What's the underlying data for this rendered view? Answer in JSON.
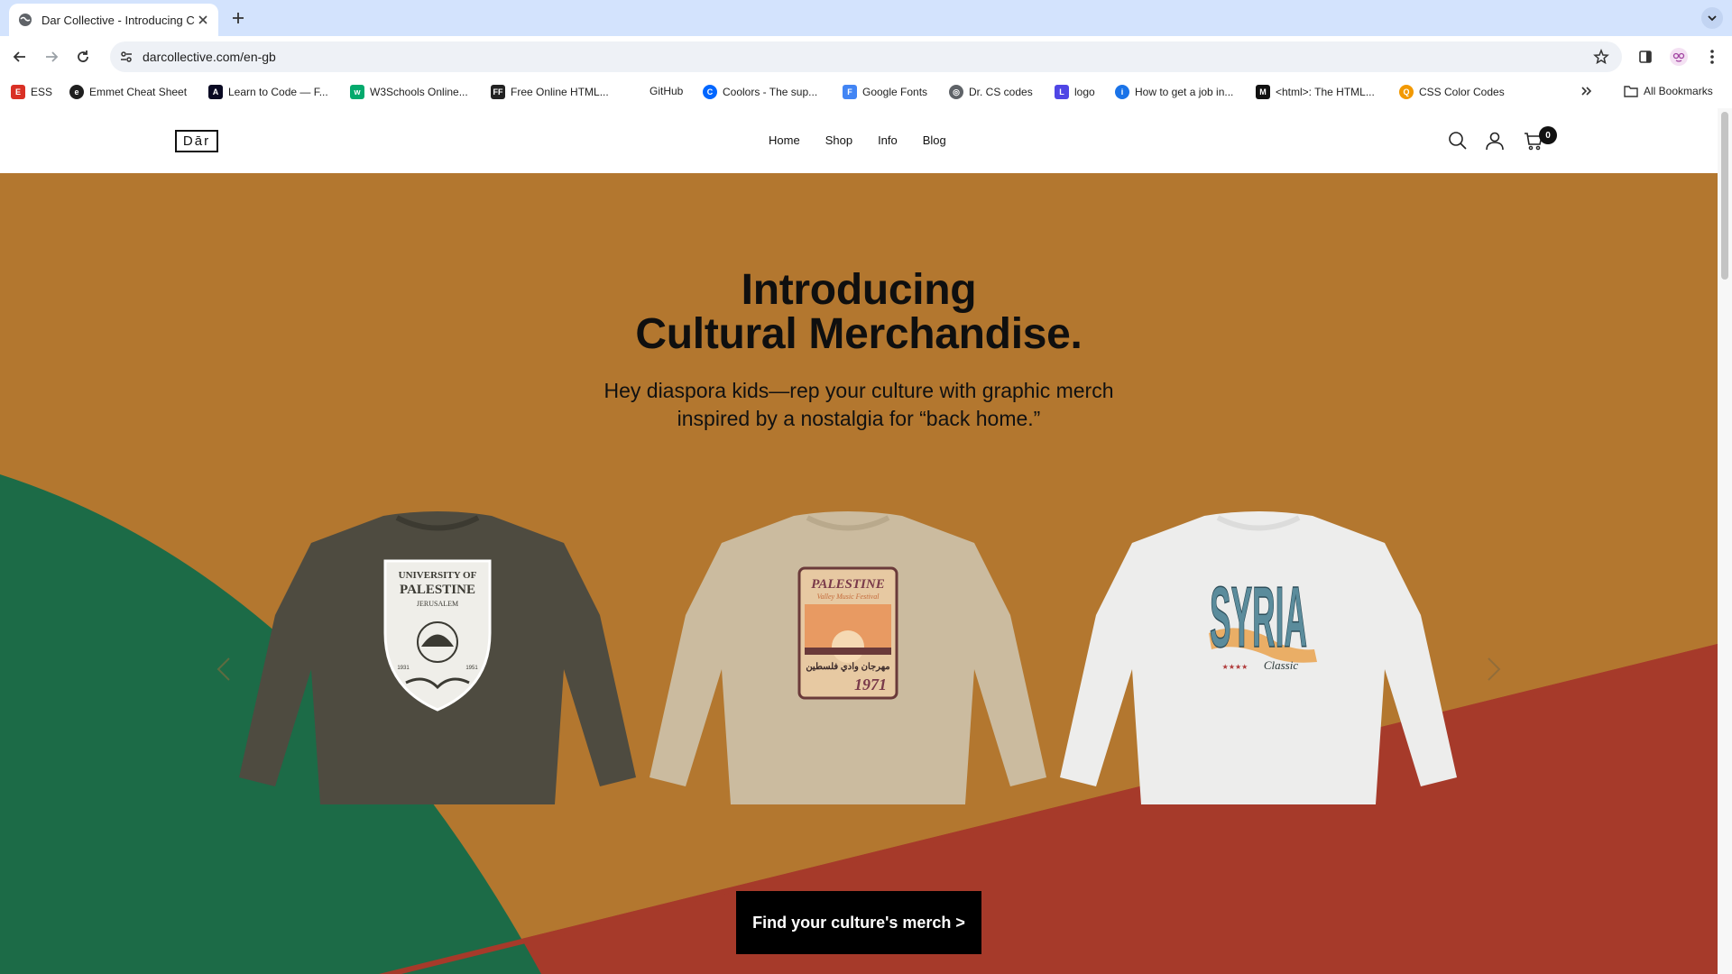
{
  "browser": {
    "tab_title": "Dar Collective - Introducing C",
    "url": "darcollective.com/en-gb",
    "bookmarks": [
      {
        "label": "ESS",
        "icon": "ess-icon",
        "color": "#d93025"
      },
      {
        "label": "Emmet Cheat Sheet",
        "icon": "emmet-icon",
        "color": "#1f1f1f"
      },
      {
        "label": "Learn to Code — F...",
        "icon": "freecodecamp-icon",
        "color": "#0a0a23"
      },
      {
        "label": "W3Schools Online...",
        "icon": "w3schools-icon",
        "color": "#04aa6d"
      },
      {
        "label": "Free Online HTML...",
        "icon": "html-editor-icon",
        "color": "#222222"
      },
      {
        "label": "GitHub",
        "icon": "",
        "color": ""
      },
      {
        "label": "Coolors - The sup...",
        "icon": "coolors-icon",
        "color": "#0066ff"
      },
      {
        "label": "Google Fonts",
        "icon": "google-fonts-icon",
        "color": "#4285f4"
      },
      {
        "label": "Dr. CS codes",
        "icon": "globe-icon",
        "color": "#5f6368"
      },
      {
        "label": "logo",
        "icon": "logo-site-icon",
        "color": "#4f46e5"
      },
      {
        "label": "How to get a job in...",
        "icon": "info-site-icon",
        "color": "#1a73e8"
      },
      {
        "label": "<html>: The HTML...",
        "icon": "mdn-icon",
        "color": "#111111"
      },
      {
        "label": "CSS Color Codes",
        "icon": "css-color-icon",
        "color": "#f29900"
      }
    ],
    "all_bookmarks_label": "All Bookmarks"
  },
  "site": {
    "logo": "Dār",
    "nav": [
      "Home",
      "Shop",
      "Info",
      "Blog"
    ],
    "cart_count": "0"
  },
  "hero": {
    "title_line1": "Introducing",
    "title_line2": "Cultural Merchandise.",
    "subtitle_line1": "Hey diaspora kids—rep your culture with graphic merch",
    "subtitle_line2": "inspired by a nostalgia for “back home.”",
    "cta": "Find your culture's merch >",
    "colors": {
      "background": "#b3772f",
      "green": "#1c6b47",
      "red": "#a63a2a"
    }
  },
  "products": [
    {
      "name": "university-of-palestine-shirt",
      "shirt_color": "#4e4b40",
      "print_line1": "UNIVERSITY OF",
      "print_line2": "PALESTINE",
      "print_line3": "JERUSALEM",
      "year_left": "1931",
      "year_right": "1951"
    },
    {
      "name": "palestine-music-festival-shirt",
      "shirt_color": "#cbbb9f",
      "print_line1": "PALESTINE",
      "print_line2": "Valley Music Festival",
      "print_line3": "1971"
    },
    {
      "name": "syria-classic-shirt",
      "shirt_color": "#ededec",
      "print_line1": "SYRIA",
      "print_line2": "Classic"
    }
  ]
}
